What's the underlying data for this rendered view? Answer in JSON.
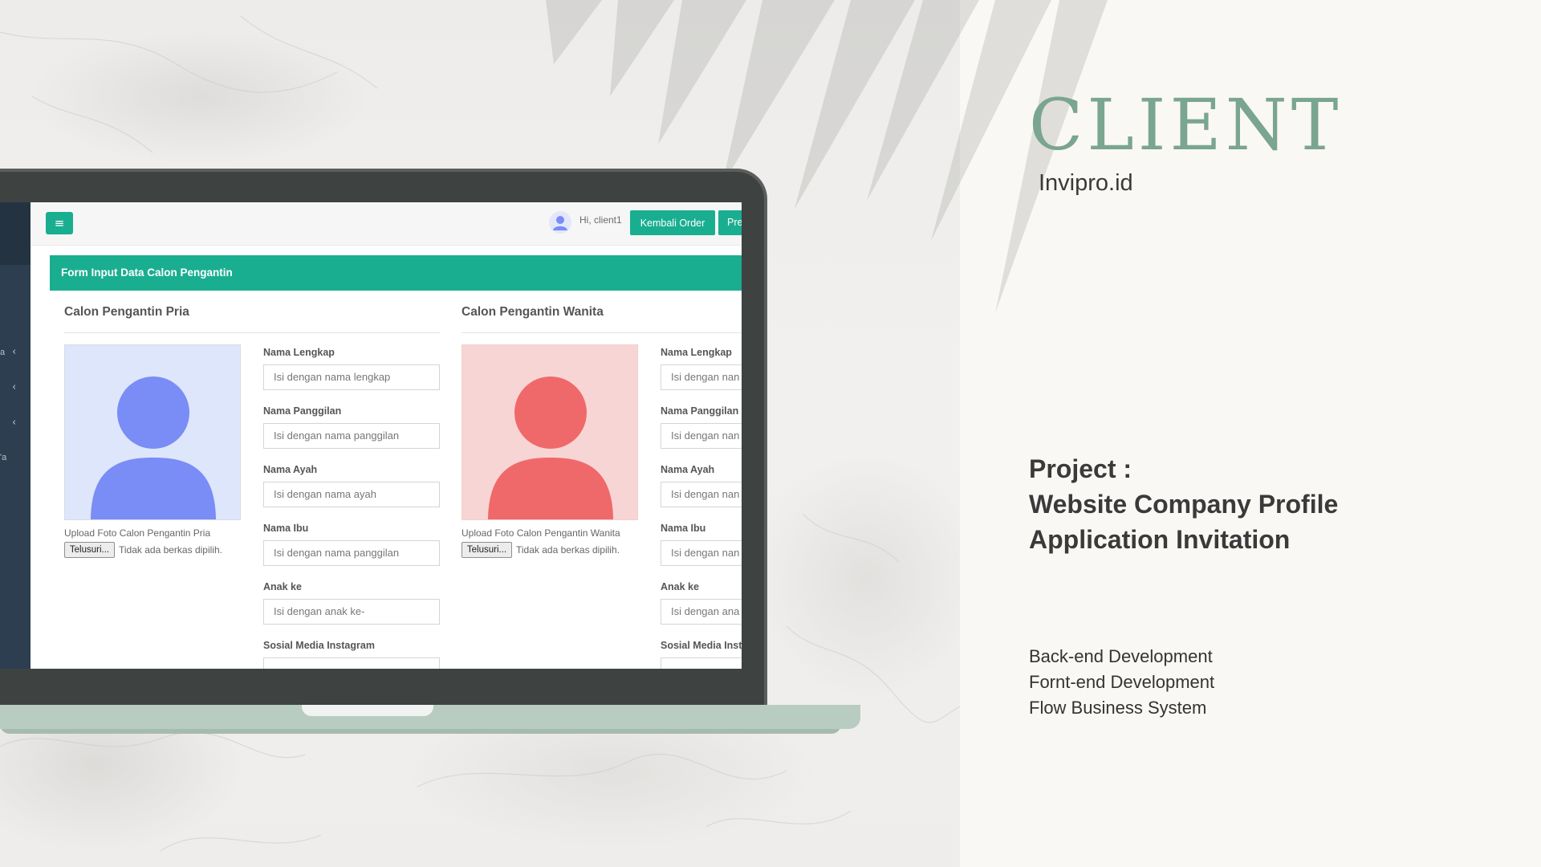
{
  "client": {
    "heading": "CLIENT",
    "name": "Invipro.id"
  },
  "project": {
    "label": "Project :",
    "lines": [
      "Website Company Profile",
      "Application Invitation"
    ]
  },
  "services": [
    "Back-end Development",
    "Fornt-end Development",
    "Flow Business System"
  ],
  "app": {
    "topbar": {
      "greeting": "Hi, client1",
      "back_button": "Kembali Order",
      "next_button_partial": "Pre"
    },
    "sidebar": {
      "fragments": [
        "a",
        "'a"
      ]
    },
    "form_title": "Form Input Data Calon Pengantin",
    "groom": {
      "title": "Calon Pengantin Pria",
      "upload_label": "Upload Foto Calon Pengantin Pria",
      "browse_button": "Telusuri...",
      "file_status": "Tidak ada berkas dipilih.",
      "fields": [
        {
          "label": "Nama Lengkap",
          "placeholder": "Isi dengan nama lengkap"
        },
        {
          "label": "Nama Panggilan",
          "placeholder": "Isi dengan nama panggilan"
        },
        {
          "label": "Nama Ayah",
          "placeholder": "Isi dengan nama ayah"
        },
        {
          "label": "Nama Ibu",
          "placeholder": "Isi dengan nama panggilan"
        },
        {
          "label": "Anak ke",
          "placeholder": "Isi dengan anak ke-"
        },
        {
          "label": "Sosial Media Instagram",
          "placeholder": ""
        }
      ]
    },
    "bride": {
      "title": "Calon Pengantin Wanita",
      "upload_label": "Upload Foto Calon Pengantin Wanita",
      "browse_button": "Telusuri...",
      "file_status": "Tidak ada berkas dipilih.",
      "fields": [
        {
          "label": "Nama Lengkap",
          "placeholder": "Isi dengan nan"
        },
        {
          "label": "Nama Panggilan",
          "placeholder": "Isi dengan nan"
        },
        {
          "label": "Nama Ayah",
          "placeholder": "Isi dengan nan"
        },
        {
          "label": "Nama Ibu",
          "placeholder": "Isi dengan nan"
        },
        {
          "label": "Anak ke",
          "placeholder": "Isi dengan ana"
        },
        {
          "label": "Sosial Media Inst",
          "placeholder": ""
        }
      ]
    }
  },
  "colors": {
    "accent": "#1aae90",
    "client_title": "#7aa590",
    "groom_avatar_bg": "#dde6fb",
    "groom_avatar": "#7a8cf5",
    "bride_avatar_bg": "#f8d5d5",
    "bride_avatar": "#f0696a",
    "sidebar": "#2c3e50",
    "laptop_frame": "#3e4342",
    "laptop_base": "#b8ccc2"
  }
}
